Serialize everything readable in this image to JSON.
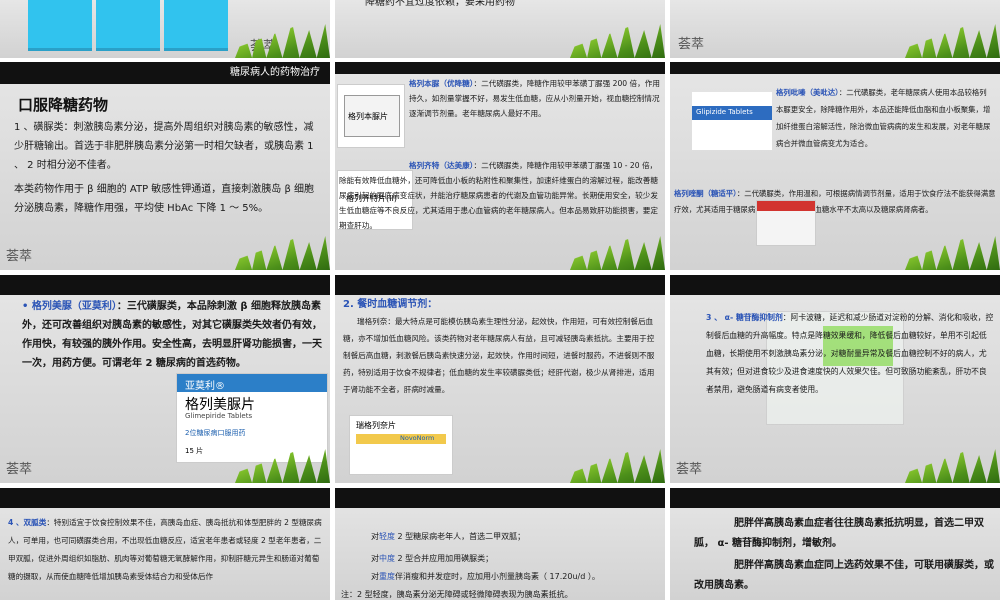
{
  "slide_top_mid": {
    "text": "降糖药不宜过度依赖，要采用药物"
  },
  "slide1": {
    "header": "糖尿病人的药物治疗",
    "title": "口服降糖药物",
    "p1": "1 、磺脲类：刺激胰岛素分泌，提高外周组织对胰岛素的敏感性，减少肝糖输出。首选于非肥胖胰岛素分泌第一时相欠缺者，或胰岛素 1 、 2 时相分泌不佳者。",
    "p2": "本类药物作用于 β 细胞的 ATP 敏感性钾通道，直接刺激胰岛 β 细胞分泌胰岛素，降糖作用强，平均使 HbAc 下降 1 ～ 5%。"
  },
  "slide2": {
    "a_title": "格列本脲（优降糖）",
    "a_text": "：二代磺脲类，降糖作用较甲苯磺丁脲强 200 倍，作用持久，如剂量掌握不好，易发生低血糖，应从小剂量开始，视血糖控制情况逐渐调节剂量。老年糖尿病人最好不用。",
    "b_title": "格列齐特（达美康）",
    "b_text": "：二代磺脲类，降糖作用较甲苯磺丁脲强 10 - 20 倍，除能有效降低血糖外，还可降低血小板的粘附性和聚集性，加速纤维蛋白的溶解过程，能改善糖尿病引起的眼底病变症状，并能治疗糖尿病患者的代谢及血管功能异常。长期使用安全，较少发生低血糖症等不良反应，尤其适用于患心血管病的老年糖尿病人。但本品易致肝功能损害，要定期查肝功。",
    "drug_a": "格列本脲片",
    "drug_b": "格列齐特片(II)"
  },
  "slide3": {
    "a_title": "格列吡嗪（美吡达）",
    "a_text": "：二代磺脲类，老年糖尿病人使用本品较格列本脲更安全，除降糖作用外，本品还能降低血脂和血小板聚集，增加纤维蛋白溶解活性，除治微血管病病的发生和发展，对老年糖尿病合并微血管病变尤为适合。",
    "b_title": "格列喹酮（糖适平）",
    "b_text": "：二代磺脲类，作用温和，可根据病情调节剂量，适用于饮食疗法不能获得满意疗效，尤其适用于糖尿病合并肾功能不全，血糖水平不太高以及糖尿病肾病者。",
    "drug_a": "Glipizide Tablets"
  },
  "slide4": {
    "title": "格列美脲（亚莫利）",
    "text": "：三代磺脲类，本品除刺激 β 细胞释放胰岛素外，还可改善组织对胰岛素的敏感性，对其它磺脲类失效者仍有效，作用快，有较强的胰外作用。安全性高，去明显肝肾功能损害，一天一次，用药方便。可谓老年 2 糖尿病的首选药物。",
    "drug_brand": "亚莫利®",
    "drug_name": "格列美脲片",
    "drug_en": "Glimepiride Tablets",
    "drug_spec": "2位糖尿病口服用药",
    "drug_count": "15 片"
  },
  "slide5": {
    "title": "2.   餐时血糖调节剂：",
    "text": "瑞格列奈：最大特点是可能模仿胰岛素生理性分泌，起效快，作用短，可有效控制餐后血糖，亦不增加低血糖风险。该类药物对老年糖尿病人有益，且可减轻胰岛素抵抗。主要用于控制餐后高血糖，刺激餐后胰岛素快速分泌，起效快，作用时间短，进餐时服药，不进餐则不服药，特别适用于饮食不规律者；低血糖的发生率较磺脲类低；经肝代谢，极少从肾排泄，适用于肾功能不全者，肝病时减量。",
    "drug_name": "瑞格列奈片",
    "drug_en": "NovoNorm"
  },
  "slide6": {
    "title": "3 、 α- 糖苷酶抑制剂",
    "text": "：阿卡波糖，延迟和减少肠道对淀粉的分解、消化和吸收，控制餐后血糖的升高幅度。特点是降糖效果缓和，降低餐后血糖较好，单用不引起低血糖，长期使用不刺激胰岛素分泌，对糖耐量异常及餐后血糖控制不好的病人，尤其有效；但对进食较少及进食速度快的人效果欠佳。但可致肠功能紊乱，肝功不良者禁用，避免肠道有病变者使用。"
  },
  "slide7": {
    "title": "4 、双胍类",
    "text": "：特别适宜于饮食控制效果不佳，高胰岛血症、胰岛抵抗和体型肥胖的 2 型糖尿病人，可单用，也可同磺脲类合用，不出现低血糖反应，适宜老年患者或轻度 2 型老年患者，二甲双胍，促进外周组织如脂肪、肌肉等对葡萄糖无氧酵解作用，抑制肝糖元异生和肠道对葡萄糖的摄取，从而使血糖降低增加胰岛素受体结合力和受体后作"
  },
  "slide8": {
    "l1_pre": "对",
    "l1_hl": "轻度",
    "l1_post": " 2 型糖尿病老年人，首选二甲双胍；",
    "l2_pre": "对",
    "l2_hl": "中度",
    "l2_post": " 2 型合并应用加用磺脲类；",
    "l3_pre": "对",
    "l3_hl": "重度",
    "l3_post": "伴消瘦和并发症时，应加用小剂量胰岛素（ 17.20u/d ）。",
    "note": "注：2 型轻度，胰岛素分泌无障碍或轻微障碍表现为胰岛素抵抗。"
  },
  "slide9": {
    "p1": "肥胖伴高胰岛素血症者往往胰岛素抵抗明显，首选二甲双胍， α- 糖苷酶抑制剂，增敏剂。",
    "p2": "肥胖伴高胰岛素血症同上选药效果不佳，可联用磺脲类，或改用胰岛素。"
  },
  "colors": {
    "blue": "#2b54b6",
    "cyan": "#31c3ee",
    "black": "#000000",
    "green": "#6fb52a"
  }
}
